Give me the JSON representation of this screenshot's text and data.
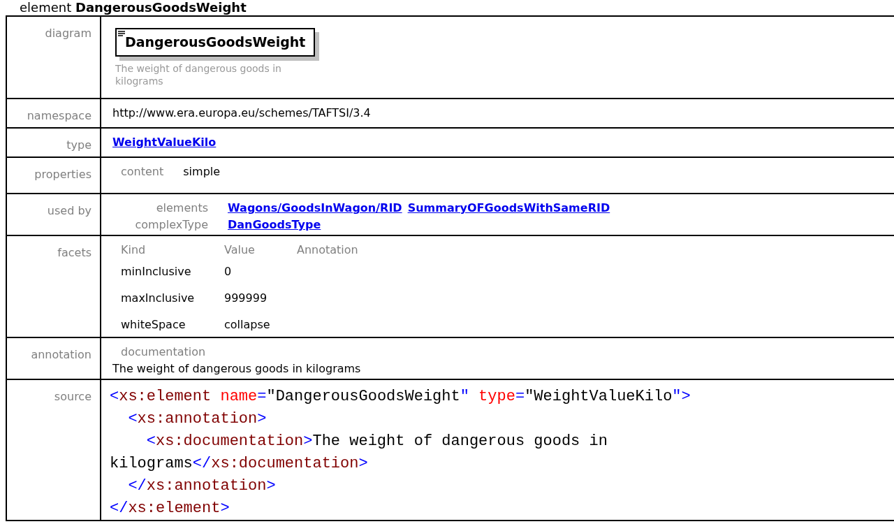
{
  "heading": {
    "prefix": "element",
    "name": "DangerousGoodsWeight"
  },
  "rows": [
    {
      "kind": "diagram",
      "label": "diagram",
      "element_name": "DangerousGoodsWeight",
      "caption": "The weight of dangerous goods in kilograms"
    },
    {
      "kind": "text",
      "label": "namespace",
      "value": "http://www.era.europa.eu/schemes/TAFTSI/3.4"
    },
    {
      "kind": "links",
      "label": "type",
      "links": [
        "WeightValueKilo"
      ]
    },
    {
      "kind": "properties",
      "label": "properties",
      "items": [
        {
          "key": "content",
          "value": "simple"
        }
      ]
    },
    {
      "kind": "used_by",
      "label": "used by",
      "groups": [
        {
          "key": "elements",
          "links": [
            "Wagons/GoodsInWagon/RID",
            "SummaryOFGoodsWithSameRID"
          ]
        },
        {
          "key": "complexType",
          "links": [
            "DanGoodsType"
          ]
        }
      ]
    },
    {
      "kind": "facets",
      "label": "facets",
      "columns": [
        "Kind",
        "Value",
        "Annotation"
      ],
      "items": [
        {
          "name": "minInclusive",
          "value": "0"
        },
        {
          "name": "maxInclusive",
          "value": "999999"
        },
        {
          "name": "whiteSpace",
          "value": "collapse"
        }
      ]
    },
    {
      "kind": "annotation",
      "label": "annotation",
      "key": "documentation",
      "text": "The weight of dangerous goods in kilograms"
    },
    {
      "kind": "source",
      "label": "source",
      "lines": [
        [
          {
            "kind": "punct",
            "text": "<"
          },
          {
            "kind": "tag",
            "text": "xs:element"
          },
          {
            "kind": "attr",
            "text": " name"
          },
          {
            "kind": "punct",
            "text": "="
          },
          {
            "kind": "text",
            "text": "\"DangerousGoodsWeight"
          },
          {
            "kind": "punct",
            "text": "\""
          },
          {
            "kind": "attr",
            "text": " type"
          },
          {
            "kind": "punct",
            "text": "="
          },
          {
            "kind": "text",
            "text": "\"WeightValueKilo"
          },
          {
            "kind": "punct",
            "text": "\">"
          }
        ],
        [
          {
            "kind": "punct",
            "text": "  <"
          },
          {
            "kind": "tag",
            "text": "xs:annotation"
          },
          {
            "kind": "punct",
            "text": ">"
          }
        ],
        [
          {
            "kind": "punct",
            "text": "    <"
          },
          {
            "kind": "tag",
            "text": "xs:documentation"
          },
          {
            "kind": "punct",
            "text": ">"
          },
          {
            "kind": "text",
            "text": "The weight of dangerous goods in"
          }
        ],
        [
          {
            "kind": "text",
            "text": "kilograms"
          },
          {
            "kind": "punct",
            "text": "</"
          },
          {
            "kind": "tag",
            "text": "xs:documentation"
          },
          {
            "kind": "punct",
            "text": ">"
          }
        ],
        [
          {
            "kind": "punct",
            "text": "  </"
          },
          {
            "kind": "tag",
            "text": "xs:annotation"
          },
          {
            "kind": "punct",
            "text": ">"
          }
        ],
        [
          {
            "kind": "punct",
            "text": "</"
          },
          {
            "kind": "tag",
            "text": "xs:element"
          },
          {
            "kind": "punct",
            "text": ">"
          }
        ]
      ]
    }
  ]
}
